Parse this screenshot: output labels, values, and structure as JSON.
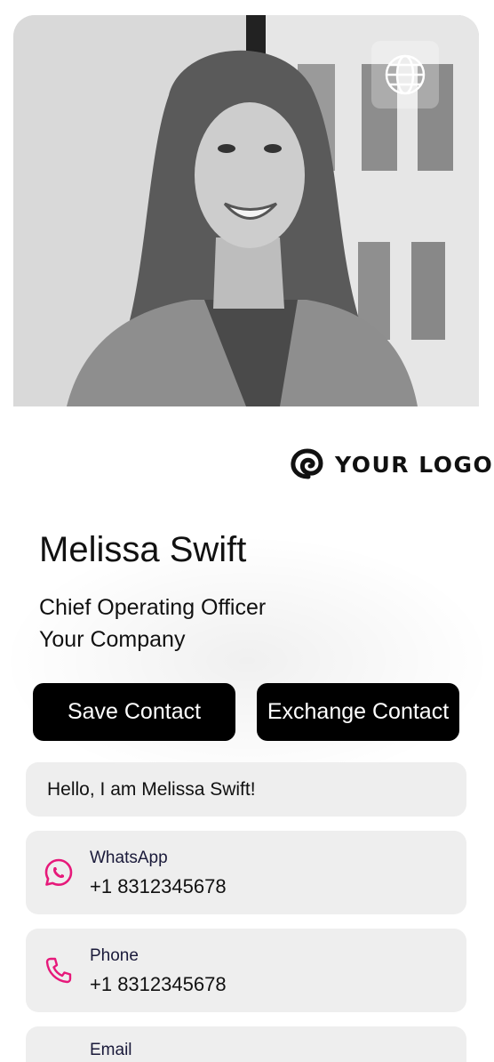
{
  "profile": {
    "name": "Melissa Swift",
    "title": "Chief Operating Officer",
    "company": "Your Company",
    "photo_alt": "Profile photo"
  },
  "logo": {
    "text": "YOUR LOGO",
    "icon": "swirl-logo-icon"
  },
  "header": {
    "language_icon": "globe-icon"
  },
  "actions": {
    "save_label": "Save Contact",
    "exchange_label": "Exchange Contact"
  },
  "greeting": "Hello, I am Melissa Swift!",
  "contacts": [
    {
      "label": "WhatsApp",
      "value": "+1 8312345678",
      "icon": "whatsapp-icon"
    },
    {
      "label": "Phone",
      "value": "+1 8312345678",
      "icon": "phone-icon"
    },
    {
      "label": "Email",
      "value": "",
      "icon": "email-icon"
    }
  ],
  "colors": {
    "accent": "#e6197a",
    "button_bg": "#000000",
    "card_bg": "#eeeeee"
  }
}
